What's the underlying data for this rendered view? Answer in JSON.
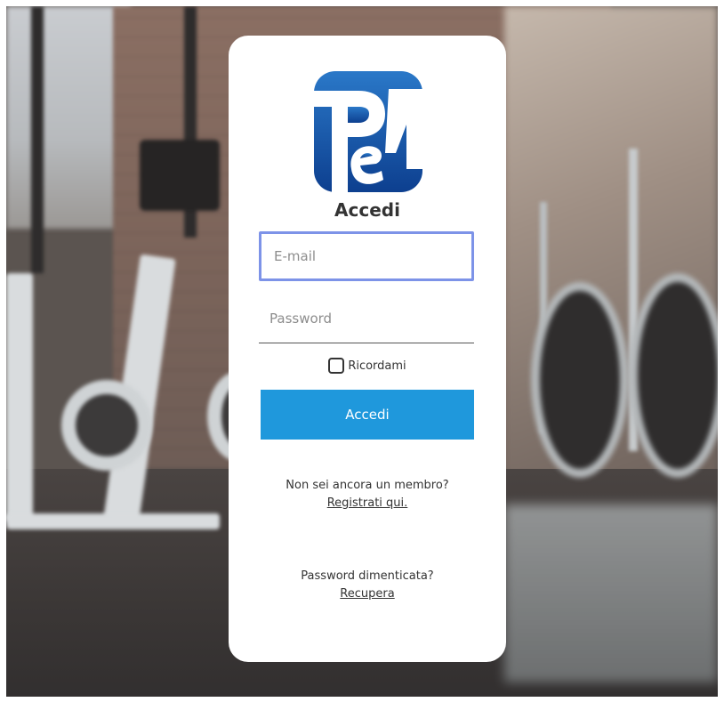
{
  "login": {
    "title": "Accedi",
    "email_placeholder": "E-mail",
    "password_placeholder": "Password",
    "remember_label": "Ricordami",
    "submit_label": "Accedi"
  },
  "signup": {
    "prompt": "Non sei ancora un membro?",
    "link": "Registrati qui."
  },
  "recovery": {
    "prompt": "Password dimenticata?",
    "link": "Recupera"
  },
  "colors": {
    "accent": "#1f98dc",
    "focus_border": "#7d93e8",
    "logo_blue_top": "#2a6fc0",
    "logo_blue_bottom": "#0d3f8f"
  },
  "logo": {
    "icon": "pem-logo-icon"
  }
}
